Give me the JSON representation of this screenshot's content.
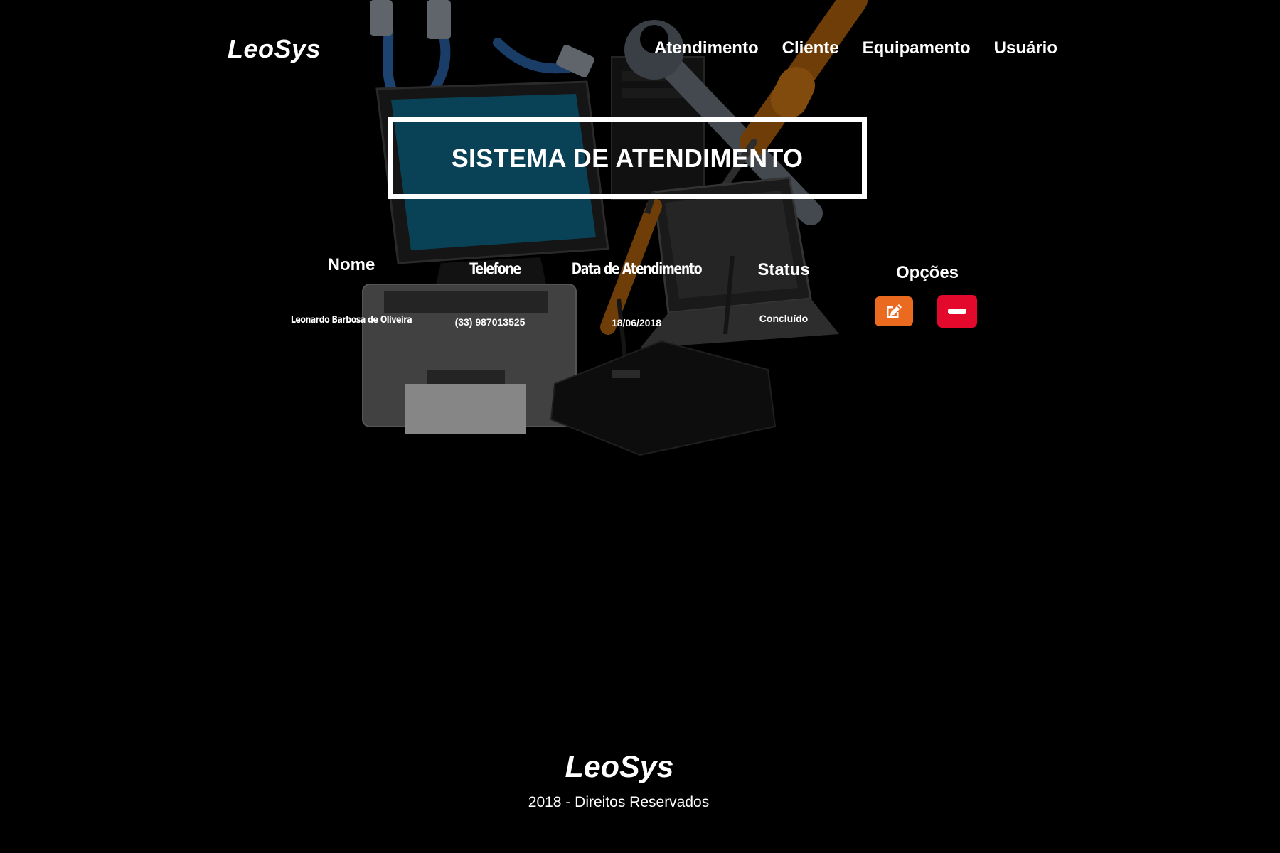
{
  "header": {
    "brand": "LeoSys",
    "nav": [
      {
        "label": "Atendimento"
      },
      {
        "label": "Cliente"
      },
      {
        "label": "Equipamento"
      },
      {
        "label": "Usuário"
      }
    ]
  },
  "main": {
    "title": "SISTEMA DE ATENDIMENTO",
    "table": {
      "columns": [
        "Nome",
        "Telefone",
        "Data de Atendimento",
        "Status",
        "Opções"
      ],
      "rows": [
        {
          "nome": "Leonardo Barbosa de Oliveira",
          "telefone": "(33) 987013525",
          "data": "18/06/2018",
          "status": "Concluído",
          "actions": {
            "edit_icon": "edit-icon",
            "delete_icon": "minus-icon"
          }
        }
      ]
    }
  },
  "footer": {
    "brand": "LeoSys",
    "copyright": "2018 - Direitos Reservados"
  },
  "colors": {
    "background": "#000000",
    "edit_button": "#ea6a1f",
    "delete_button": "#e3092c",
    "text": "#ffffff"
  }
}
